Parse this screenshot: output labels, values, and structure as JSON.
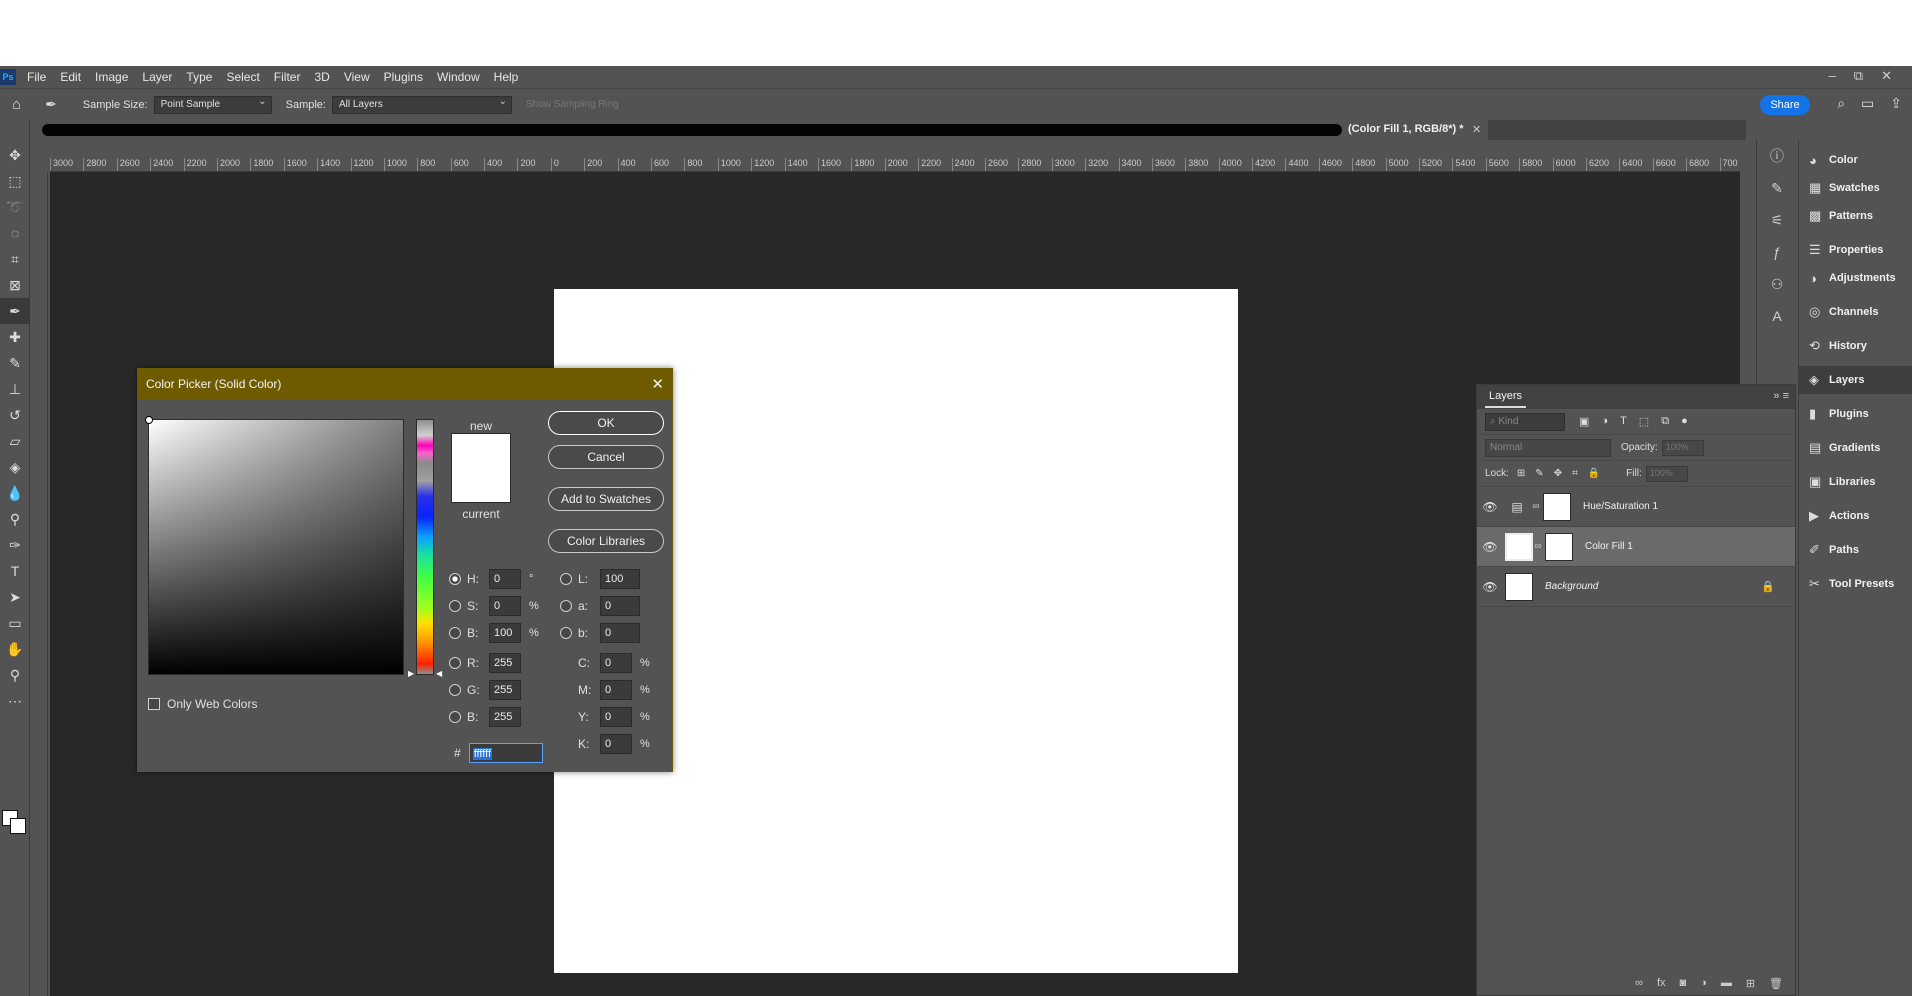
{
  "app": {
    "logo": "Ps"
  },
  "menu": [
    "File",
    "Edit",
    "Image",
    "Layer",
    "Type",
    "Select",
    "Filter",
    "3D",
    "View",
    "Plugins",
    "Window",
    "Help"
  ],
  "window_controls": {
    "minimize": "–",
    "restore": "⧉",
    "close": "✕"
  },
  "options": {
    "sample_size_label": "Sample Size:",
    "sample_size_value": "Point Sample",
    "sample_label": "Sample:",
    "sample_value": "All Layers",
    "show_ring": "Show Sampling Ring",
    "share": "Share"
  },
  "document_tab": {
    "title": "(Color Fill 1, RGB/8*) *",
    "close": "✕"
  },
  "ruler_labels": [
    "3000",
    "2800",
    "2600",
    "2400",
    "2200",
    "2000",
    "1800",
    "1600",
    "1400",
    "1200",
    "1000",
    "800",
    "600",
    "400",
    "200",
    "0",
    "200",
    "400",
    "600",
    "800",
    "1000",
    "1200",
    "1400",
    "1600",
    "1800",
    "2000",
    "2200",
    "2400",
    "2600",
    "2800",
    "3000",
    "3200",
    "3400",
    "3600",
    "3800",
    "4000",
    "4200",
    "4400",
    "4600",
    "4800",
    "5000",
    "5200",
    "5400",
    "5600",
    "5800",
    "6000",
    "6200",
    "6400",
    "6600",
    "6800",
    "700"
  ],
  "panels": {
    "entries": [
      {
        "label": "Color",
        "icon": "color-icon"
      },
      {
        "label": "Swatches",
        "icon": "swatches-icon"
      },
      {
        "label": "Patterns",
        "icon": "patterns-icon"
      },
      {
        "label": "Properties",
        "icon": "properties-icon"
      },
      {
        "label": "Adjustments",
        "icon": "adjustments-icon"
      },
      {
        "label": "Channels",
        "icon": "channels-icon"
      },
      {
        "label": "History",
        "icon": "history-icon"
      },
      {
        "label": "Layers",
        "icon": "layers-icon"
      },
      {
        "label": "Plugins",
        "icon": "plugins-icon"
      },
      {
        "label": "Gradients",
        "icon": "gradients-icon"
      },
      {
        "label": "Libraries",
        "icon": "libraries-icon"
      },
      {
        "label": "Actions",
        "icon": "actions-icon"
      },
      {
        "label": "Paths",
        "icon": "paths-icon"
      },
      {
        "label": "Tool Presets",
        "icon": "tool-presets-icon"
      }
    ]
  },
  "layers_panel": {
    "tab": "Layers",
    "kind_placeholder": "Kind",
    "blend_mode": "Normal",
    "opacity_label": "Opacity:",
    "opacity_value": "100%",
    "lock_label": "Lock:",
    "fill_label": "Fill:",
    "fill_value": "100%",
    "layers": [
      {
        "name": "Hue/Saturation 1"
      },
      {
        "name": "Color Fill 1"
      },
      {
        "name": "Background"
      }
    ]
  },
  "color_picker": {
    "title": "Color Picker (Solid Color)",
    "close": "✕",
    "new_label": "new",
    "current_label": "current",
    "ok": "OK",
    "cancel": "Cancel",
    "add_to_swatches": "Add to Swatches",
    "color_libraries": "Color Libraries",
    "only_web_colors": "Only Web Colors",
    "hsb": {
      "h": "0",
      "s": "0",
      "b": "100",
      "h_unit": "°",
      "s_unit": "%",
      "b_unit": "%"
    },
    "rgb": {
      "r": "255",
      "g": "255",
      "b": "255"
    },
    "lab": {
      "l": "100",
      "a": "0",
      "b": "0"
    },
    "cmyk": {
      "c": "0",
      "m": "0",
      "y": "0",
      "k": "0",
      "unit": "%"
    },
    "labels": {
      "h": "H:",
      "s": "S:",
      "b": "B:",
      "r": "R:",
      "g": "G:",
      "b2": "B:",
      "l": "L:",
      "a": "a:",
      "lb": "b:",
      "c": "C:",
      "m": "M:",
      "y": "Y:",
      "k": "K:",
      "hash": "#"
    },
    "hex": "ffffff",
    "current_color": "#ffffff"
  }
}
